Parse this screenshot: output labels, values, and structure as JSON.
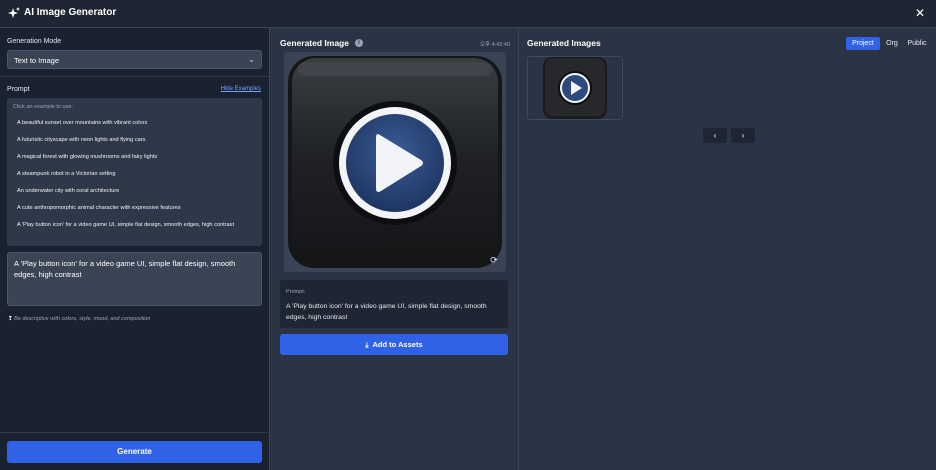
{
  "app": {
    "title": "AI Image Generator"
  },
  "left": {
    "mode_label": "Generation Mode",
    "mode_value": "Text to Image",
    "prompt_label": "Prompt",
    "hide_examples": "Hide Examples",
    "examples_hint": "Click an example to use:",
    "examples": [
      "A beautiful sunset over mountains with vibrant colors",
      "A futuristic cityscape with neon lights and flying cars",
      "A magical forest with glowing mushrooms and fairy lights",
      "A steampunk robot in a Victorian setting",
      "An underwater city with coral architecture",
      "A cute anthropomorphic animal character with expressive features",
      "A 'Play button icon' for a video game UI, simple flat design, smooth edges, high contrast"
    ],
    "prompt_value": "A 'Play button icon' for a video game UI, simple flat design, smooth edges, high contrast",
    "tip": "Be descriptive with colors, style, mood, and composition",
    "generate_label": "Generate"
  },
  "mid": {
    "title": "Generated Image",
    "timestamp": "오후 4:42:40",
    "prompt_label": "Prompt:",
    "prompt_text": "A 'Play button icon' for a video game UI, simple flat design, smooth edges, high contrast",
    "add_assets_label": "Add to Assets"
  },
  "right": {
    "title": "Generated Images",
    "tabs": [
      "Project",
      "Org",
      "Public"
    ],
    "active_tab": "Project",
    "prev_label": "‹",
    "next_label": "›"
  },
  "colors": {
    "accent": "#2f62e6",
    "panel_dark": "#1a2130",
    "panel": "#2b3444",
    "icon_blue": "#2e4a7d"
  },
  "icons": [
    "sparkles-icon",
    "close-icon",
    "chevron-down-icon",
    "info-icon",
    "refresh-icon",
    "download-icon",
    "lightbulb-icon",
    "chevron-left-icon",
    "chevron-right-icon"
  ]
}
